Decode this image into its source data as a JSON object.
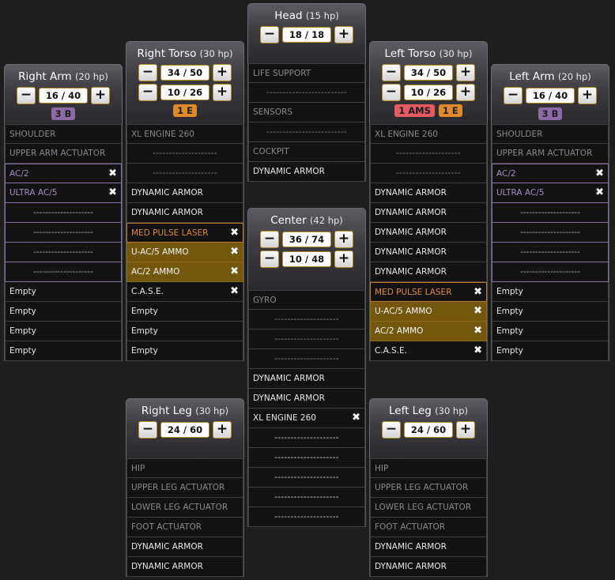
{
  "head": {
    "title": "Head",
    "hp": "(15 hp)",
    "armor": [
      "18 / 18"
    ],
    "slots": [
      "LIFE SUPPORT",
      "-------------------------",
      "SENSORS",
      "-------------------------",
      "COCKPIT",
      "DYNAMIC ARMOR"
    ]
  },
  "right_arm": {
    "title": "Right Arm",
    "hp": "(20 hp)",
    "armor": [
      "16 / 40"
    ],
    "badges": [
      "3 B"
    ],
    "slots": [
      "SHOULDER",
      "UPPER ARM ACTUATOR",
      "AC/2",
      "ULTRA AC/5",
      "--------------------",
      "--------------------",
      "--------------------",
      "--------------------",
      "Empty",
      "Empty",
      "Empty",
      "Empty"
    ]
  },
  "left_arm": {
    "title": "Left Arm",
    "hp": "(20 hp)",
    "armor": [
      "16 / 40"
    ],
    "badges": [
      "3 B"
    ],
    "slots": [
      "SHOULDER",
      "UPPER ARM ACTUATOR",
      "AC/2",
      "ULTRA AC/5",
      "--------------------",
      "--------------------",
      "--------------------",
      "--------------------",
      "Empty",
      "Empty",
      "Empty",
      "Empty"
    ]
  },
  "right_torso": {
    "title": "Right Torso",
    "hp": "(30 hp)",
    "armor": [
      "34 / 50",
      "10 / 26"
    ],
    "badges": [
      "1 E"
    ],
    "slots": [
      "XL ENGINE 260",
      "--------------------",
      "--------------------",
      "DYNAMIC ARMOR",
      "DYNAMIC ARMOR",
      "MED PULSE LASER",
      "U-AC/5 AMMO",
      "AC/2 AMMO",
      "C.A.S.E.",
      "Empty",
      "Empty",
      "Empty"
    ]
  },
  "left_torso": {
    "title": "Left Torso",
    "hp": "(30 hp)",
    "armor": [
      "34 / 50",
      "10 / 26"
    ],
    "badges": [
      "1 AMS",
      "1 E"
    ],
    "slots": [
      "XL ENGINE 260",
      "--------------------",
      "--------------------",
      "DYNAMIC ARMOR",
      "DYNAMIC ARMOR",
      "DYNAMIC ARMOR",
      "DYNAMIC ARMOR",
      "DYNAMIC ARMOR",
      "MED PULSE LASER",
      "U-AC/5 AMMO",
      "AC/2 AMMO",
      "C.A.S.E."
    ]
  },
  "center": {
    "title": "Center",
    "hp": "(42 hp)",
    "armor": [
      "36 / 74",
      "10 / 48"
    ],
    "slots": [
      "GYRO",
      "--------------------",
      "--------------------",
      "--------------------",
      "DYNAMIC ARMOR",
      "DYNAMIC ARMOR",
      "XL ENGINE 260",
      "--------------------",
      "--------------------",
      "--------------------",
      "--------------------",
      "--------------------"
    ]
  },
  "right_leg": {
    "title": "Right Leg",
    "hp": "(30 hp)",
    "armor": [
      "24 / 60"
    ],
    "slots": [
      "HIP",
      "UPPER LEG ACTUATOR",
      "LOWER LEG ACTUATOR",
      "FOOT ACTUATOR",
      "DYNAMIC ARMOR",
      "DYNAMIC ARMOR"
    ]
  },
  "left_leg": {
    "title": "Left Leg",
    "hp": "(30 hp)",
    "armor": [
      "24 / 60"
    ],
    "slots": [
      "HIP",
      "UPPER LEG ACTUATOR",
      "LOWER LEG ACTUATOR",
      "FOOT ACTUATOR",
      "DYNAMIC ARMOR",
      "DYNAMIC ARMOR"
    ]
  },
  "icons": {
    "minus": "−",
    "plus": "+",
    "remove": "✖"
  },
  "colors": {
    "background": "#1e1e1e",
    "weapon_text": "#a78cc4",
    "laser_text": "#e38a35",
    "ammo_bg": "#73570c",
    "badge_ballistic": "#8e6aa8",
    "badge_energy": "#dd8a2a",
    "badge_ams": "#e55b63"
  }
}
